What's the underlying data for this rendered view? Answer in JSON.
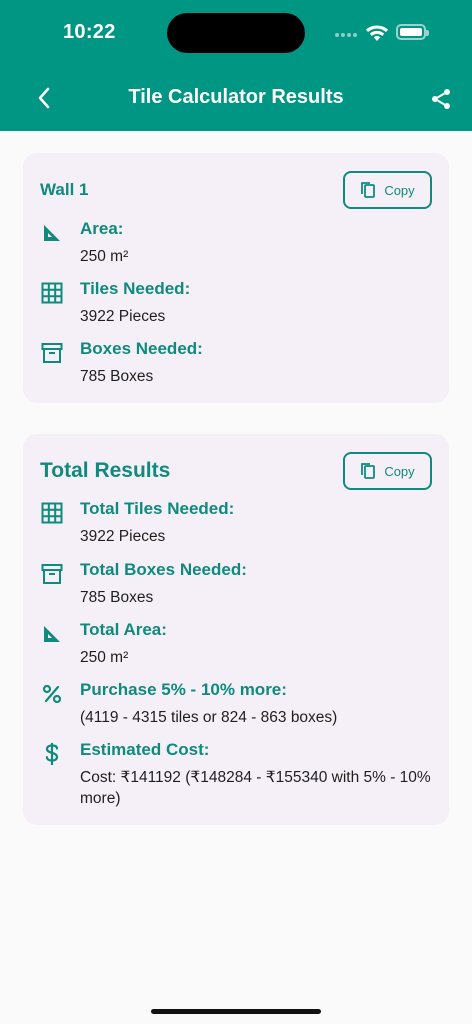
{
  "status": {
    "time": "10:22"
  },
  "header": {
    "title": "Tile Calculator Results"
  },
  "wall": {
    "title": "Wall 1",
    "copy_label": "Copy",
    "rows": [
      {
        "icon": "ruler-square-icon",
        "label": "Area:",
        "value": "250 m²"
      },
      {
        "icon": "grid-icon",
        "label": "Tiles Needed:",
        "value": "3922 Pieces"
      },
      {
        "icon": "archive-box-icon",
        "label": "Boxes Needed:",
        "value": "785 Boxes"
      }
    ]
  },
  "totals": {
    "title": "Total Results",
    "copy_label": "Copy",
    "rows": [
      {
        "icon": "grid-icon",
        "label": "Total Tiles Needed:",
        "value": "3922 Pieces"
      },
      {
        "icon": "archive-box-icon",
        "label": "Total Boxes Needed:",
        "value": "785 Boxes"
      },
      {
        "icon": "ruler-square-icon",
        "label": "Total Area:",
        "value": "250 m²"
      },
      {
        "icon": "percent-icon",
        "label": "Purchase 5% - 10% more:",
        "value": "(4119 - 4315 tiles or 824 - 863 boxes)"
      },
      {
        "icon": "dollar-icon",
        "label": "Estimated Cost:",
        "value": "Cost: ₹141192 (₹148284 - ₹155340 with 5% - 10% more)"
      }
    ]
  },
  "colors": {
    "primary": "#009684",
    "accent_text": "#0f8a7d",
    "card_bg": "#f5f0f7",
    "page_bg": "#fafafa"
  }
}
